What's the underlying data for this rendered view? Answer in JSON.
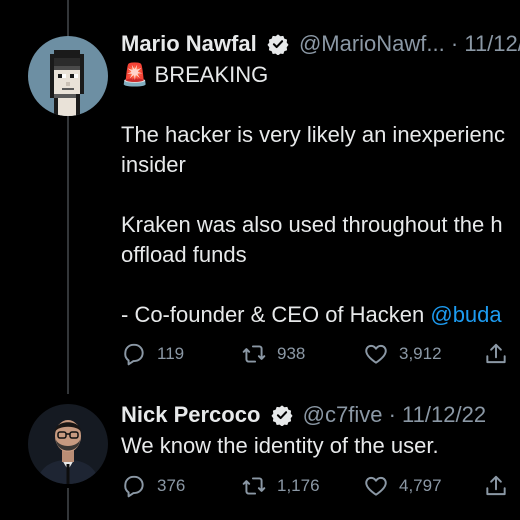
{
  "tweets": [
    {
      "author": {
        "name": "Mario Nawfal",
        "handle": "@MarioNawf...",
        "separator": "·",
        "date": "11/12/"
      },
      "headline_emoji": "🚨",
      "headline": "BREAKING",
      "lines": [
        "The hacker is very likely an inexperienc",
        "insider",
        "Kraken was also used throughout the h",
        "offload funds",
        "- Co-founder & CEO of Hacken "
      ],
      "mention": "@buda",
      "stats": {
        "replies": "119",
        "retweets": "938",
        "likes": "3,912"
      }
    },
    {
      "author": {
        "name": "Nick Percoco",
        "handle": "@c7five",
        "separator": "·",
        "date": "11/12/22"
      },
      "lines": [
        "We know the identity of the user."
      ],
      "stats": {
        "replies": "376",
        "retweets": "1,176",
        "likes": "4,797"
      }
    }
  ],
  "icons": {
    "reply": "reply-icon",
    "retweet": "retweet-icon",
    "like": "heart-icon",
    "share": "share-icon",
    "verified": "verified-badge-icon"
  },
  "colors": {
    "background": "#000000",
    "text": "#e7e9ea",
    "muted": "#8b98a5",
    "link": "#1d9bf0",
    "thread_line": "#333639"
  }
}
